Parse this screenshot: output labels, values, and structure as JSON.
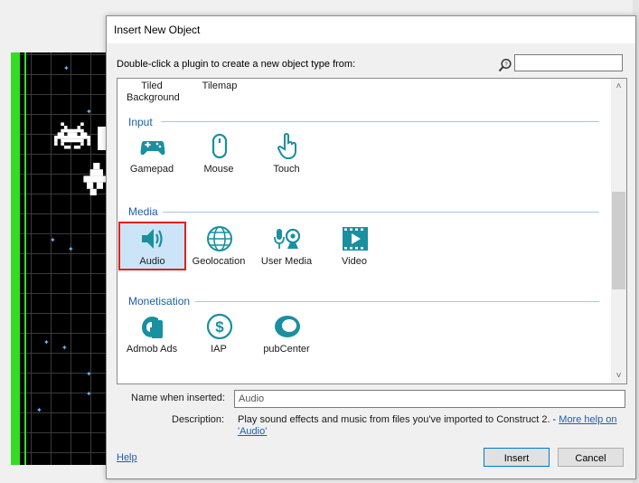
{
  "dialog": {
    "title": "Insert New Object",
    "instruction": "Double-click a plugin to create a new object type from:",
    "search": {
      "value": "",
      "placeholder": ""
    }
  },
  "plugin_list": {
    "top_items": [
      {
        "label": "Tiled\nBackground"
      },
      {
        "label": "Tilemap"
      }
    ],
    "categories": [
      {
        "name": "Input",
        "items": [
          {
            "label": "Gamepad",
            "icon": "gamepad-icon"
          },
          {
            "label": "Mouse",
            "icon": "mouse-icon"
          },
          {
            "label": "Touch",
            "icon": "touch-hand-icon"
          }
        ]
      },
      {
        "name": "Media",
        "items": [
          {
            "label": "Audio",
            "icon": "speaker-icon",
            "selected": true
          },
          {
            "label": "Geolocation",
            "icon": "globe-icon"
          },
          {
            "label": "User Media",
            "icon": "webcam-microphone-icon"
          },
          {
            "label": "Video",
            "icon": "video-film-icon"
          }
        ]
      },
      {
        "name": "Monetisation",
        "items": [
          {
            "label": "Admob Ads",
            "icon": "admob-icon"
          },
          {
            "label": "IAP",
            "icon": "dollar-icon"
          },
          {
            "label": "pubCenter",
            "icon": "pubcenter-icon"
          }
        ]
      }
    ]
  },
  "fields": {
    "name_label": "Name when inserted:",
    "name_value": "Audio",
    "description_label": "Description:",
    "description_text": "Play sound effects and music from files you've imported to Construct 2. - ",
    "more_help_link": "More help on 'Audio'"
  },
  "footer": {
    "help_link": "Help",
    "insert_button": "Insert",
    "cancel_button": "Cancel"
  },
  "colors": {
    "accent": "#1b5fa8",
    "icon_teal": "#1a8fa0",
    "selection_bg": "#cce4f7",
    "selection_border": "#e02020",
    "layout_green": "#33dd22"
  }
}
